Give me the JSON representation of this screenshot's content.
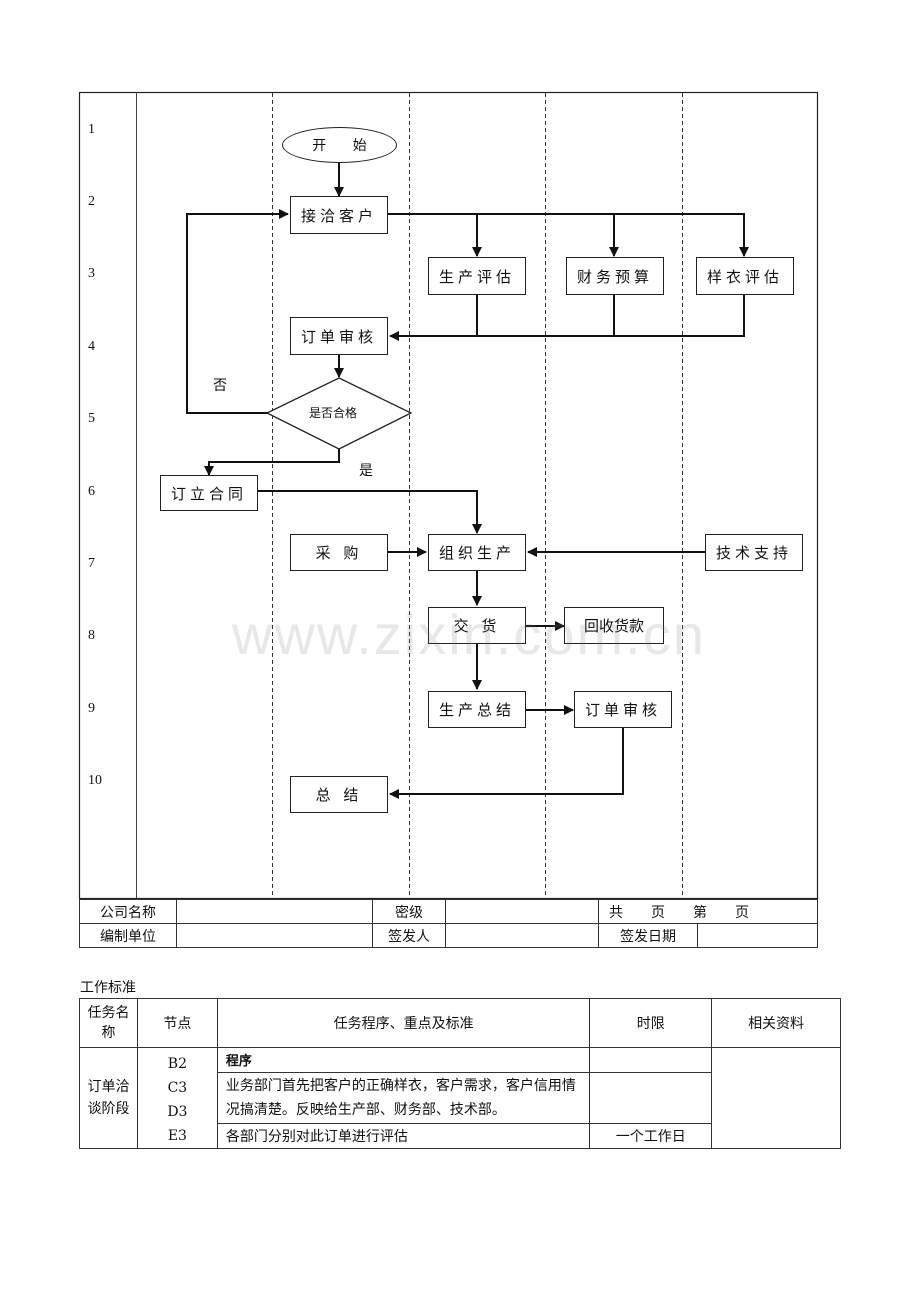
{
  "flowchart": {
    "row_numbers": [
      "1",
      "2",
      "3",
      "4",
      "5",
      "6",
      "7",
      "8",
      "9",
      "10"
    ],
    "nodes": {
      "start": "开 始",
      "reception": "接洽客户",
      "production_eval": "生产评估",
      "finance_budget": "财务预算",
      "sample_eval": "样衣评估",
      "order_review": "订单审核",
      "decision": "是否合格",
      "sign_contract": "订立合同",
      "purchase": "采 购",
      "organize_production": "组织生产",
      "tech_support": "技术支持",
      "delivery": "交 货",
      "collect_payment": "回收货款",
      "production_summary": "生产总结",
      "order_review_2": "订单审核",
      "summary": "总 结"
    },
    "edge_labels": {
      "no": "否",
      "yes": "是"
    }
  },
  "meta_table": {
    "company_name_label": "公司名称",
    "company_name_value": "",
    "secrecy_label": "密级",
    "secrecy_value": "",
    "page_label": "共　　页　　第　　页",
    "prepared_by_label": "编制单位",
    "prepared_by_value": "",
    "issuer_label": "签发人",
    "issuer_value": "",
    "issue_date_label": "签发日期",
    "issue_date_value": ""
  },
  "work_standard": {
    "title": "工作标准",
    "headers": {
      "task_name": "任务名称",
      "node": "节点",
      "procedure": "任务程序、重点及标准",
      "time_limit": "时限",
      "references": "相关资料"
    },
    "task": "订单洽谈阶段",
    "nodes": [
      "B2",
      "C3",
      "D3",
      "E3"
    ],
    "rows": [
      {
        "procedure": "程序",
        "time_limit": ""
      },
      {
        "procedure": "业务部门首先把客户的正确样衣，客户需求，客户信用情况搞清楚。反映给生产部、财务部、技术部。",
        "time_limit": ""
      },
      {
        "procedure": "各部门分别对此订单进行评估",
        "time_limit": "一个工作日"
      }
    ],
    "references": ""
  },
  "watermark": "www.zixin.com.cn"
}
